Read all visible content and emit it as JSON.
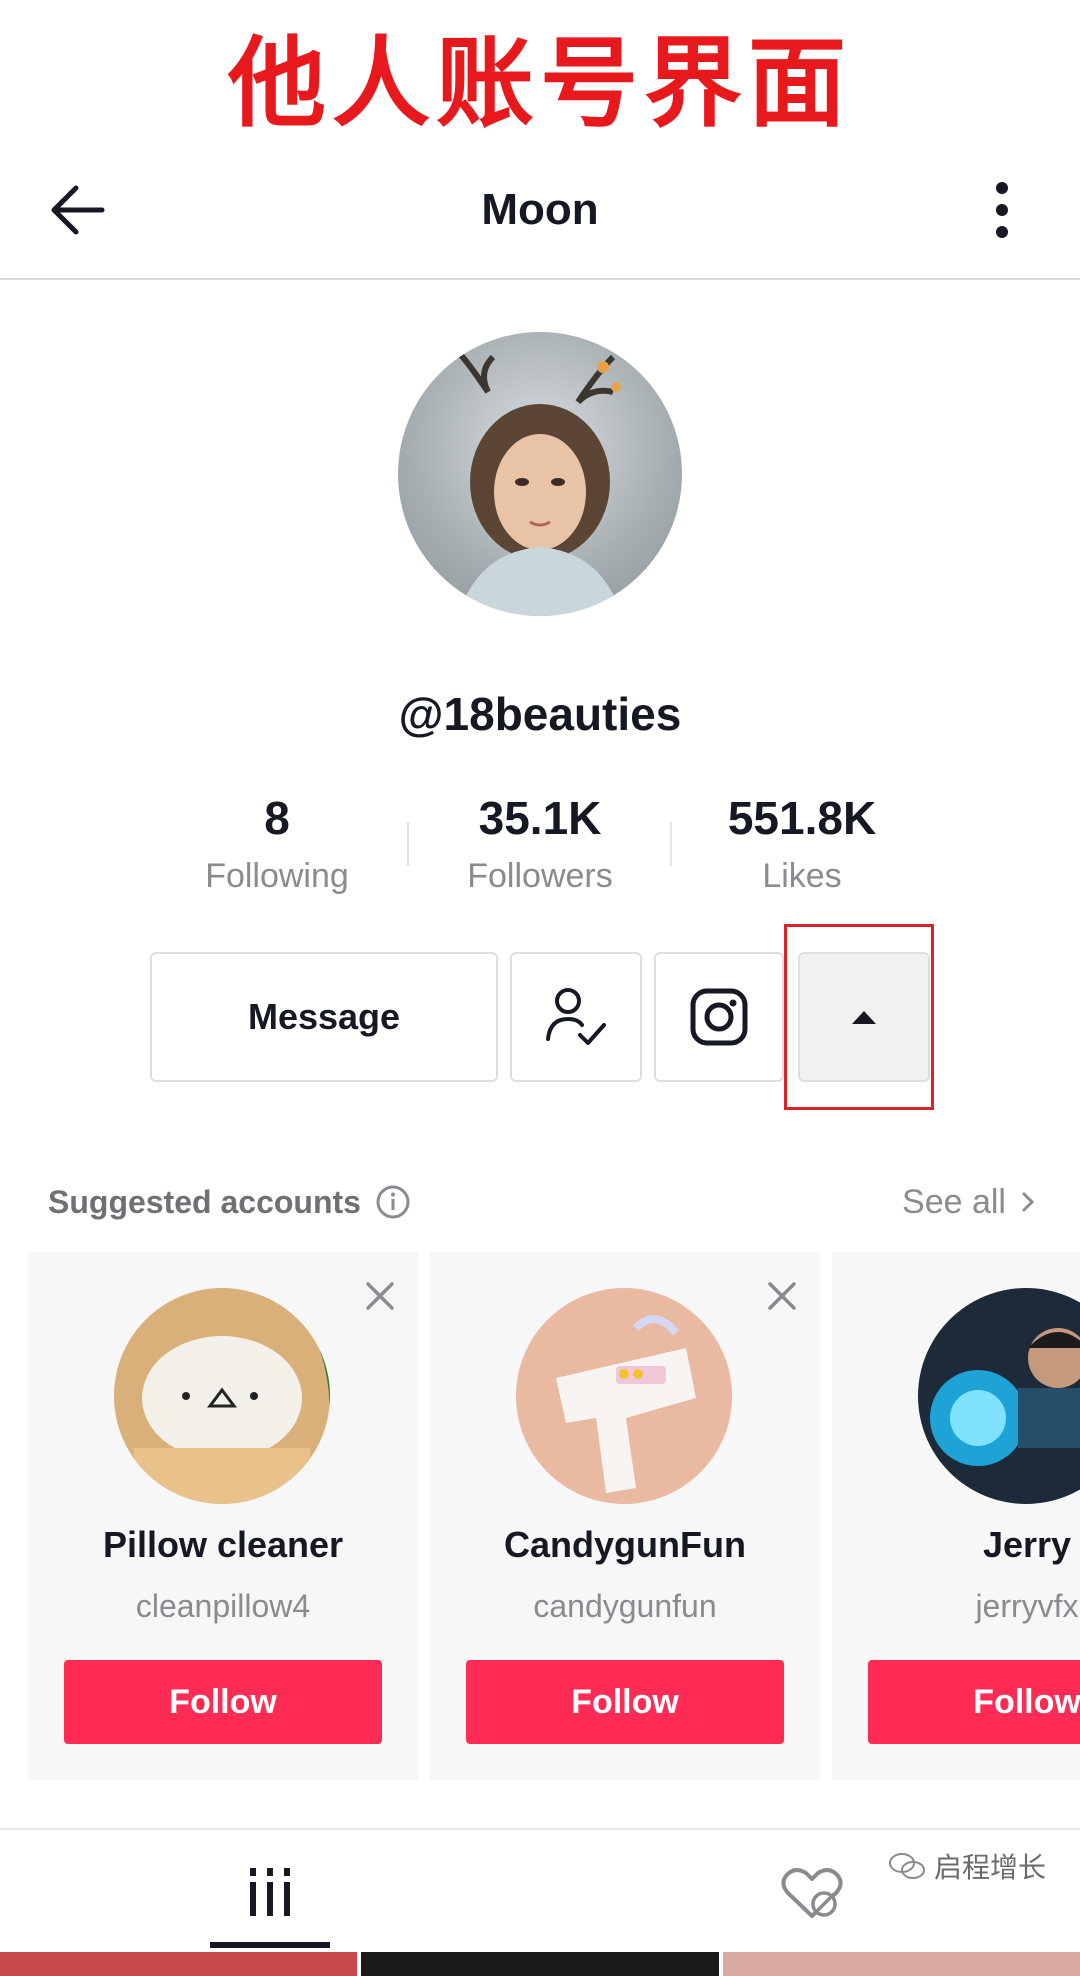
{
  "banner": {
    "text": "他人账号界面"
  },
  "header": {
    "title": "Moon"
  },
  "profile": {
    "username": "@18beauties",
    "stats": [
      {
        "value": "8",
        "label": "Following"
      },
      {
        "value": "35.1K",
        "label": "Followers"
      },
      {
        "value": "551.8K",
        "label": "Likes"
      }
    ]
  },
  "actions": {
    "message_label": "Message"
  },
  "suggested": {
    "title": "Suggested accounts",
    "see_all": "See all",
    "accounts": [
      {
        "name": "Pillow cleaner",
        "handle": "cleanpillow4",
        "follow": "Follow"
      },
      {
        "name": "CandygunFun",
        "handle": "candygunfun",
        "follow": "Follow"
      },
      {
        "name": "Jerry",
        "handle": "jerryvfx",
        "follow": "Follow"
      }
    ]
  },
  "watermark": {
    "text": "启程增长"
  },
  "colors": {
    "accent": "#fe2c55",
    "banner": "#e8191d",
    "highlight_box": "#d6262c"
  }
}
